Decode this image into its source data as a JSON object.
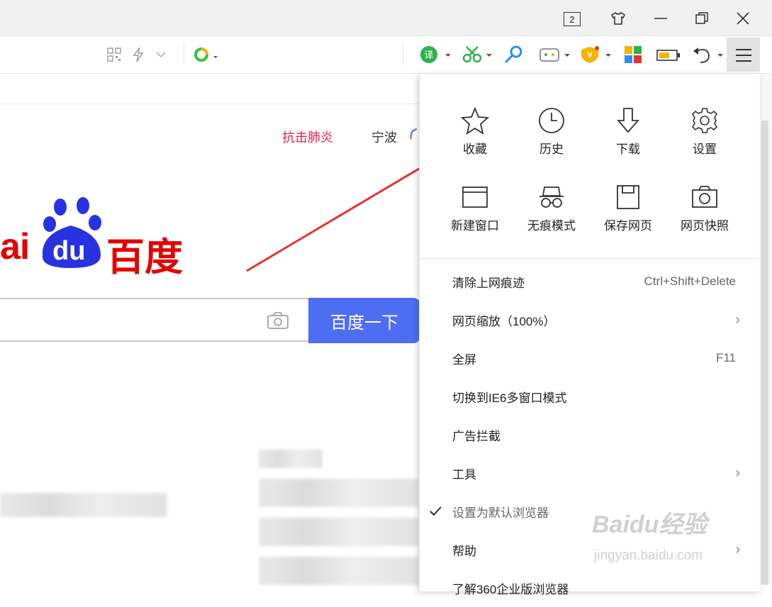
{
  "window": {
    "tab_count": "2"
  },
  "toolbar": {
    "address_text": ""
  },
  "page": {
    "news_link": "抗击肺炎",
    "city": "宁波",
    "logo_text": "百度",
    "logo_du": "du",
    "logo_prefix": "ai",
    "search_placeholder": "",
    "search_button": "百度一下"
  },
  "menu": {
    "grid": [
      {
        "label": "收藏",
        "icon": "star-icon"
      },
      {
        "label": "历史",
        "icon": "clock-icon"
      },
      {
        "label": "下载",
        "icon": "download-icon"
      },
      {
        "label": "设置",
        "icon": "gear-icon"
      },
      {
        "label": "新建窗口",
        "icon": "window-icon"
      },
      {
        "label": "无痕模式",
        "icon": "incognito-icon"
      },
      {
        "label": "保存网页",
        "icon": "save-icon"
      },
      {
        "label": "网页快照",
        "icon": "camera-icon"
      }
    ],
    "items": [
      {
        "label": "清除上网痕迹",
        "shortcut": "Ctrl+Shift+Delete"
      },
      {
        "label": "网页缩放（100%）",
        "submenu": true
      },
      {
        "label": "全屏",
        "shortcut": "F11"
      },
      {
        "label": "切换到IE6多窗口模式"
      },
      {
        "label": "广告拦截"
      },
      {
        "label": "工具",
        "submenu": true
      },
      {
        "label": "设置为默认浏览器",
        "checked": true
      },
      {
        "label": "帮助",
        "submenu": true
      },
      {
        "label": "了解360企业版浏览器"
      }
    ]
  },
  "watermark": {
    "brand": "Baidu经验",
    "url": "jingyan.baidu.com"
  },
  "colors": {
    "accent_blue": "#4e6ef2",
    "news_red": "#e2234b",
    "arrow_red": "#e8322a",
    "logo_red": "#e10601",
    "logo_blue": "#2932e1"
  }
}
